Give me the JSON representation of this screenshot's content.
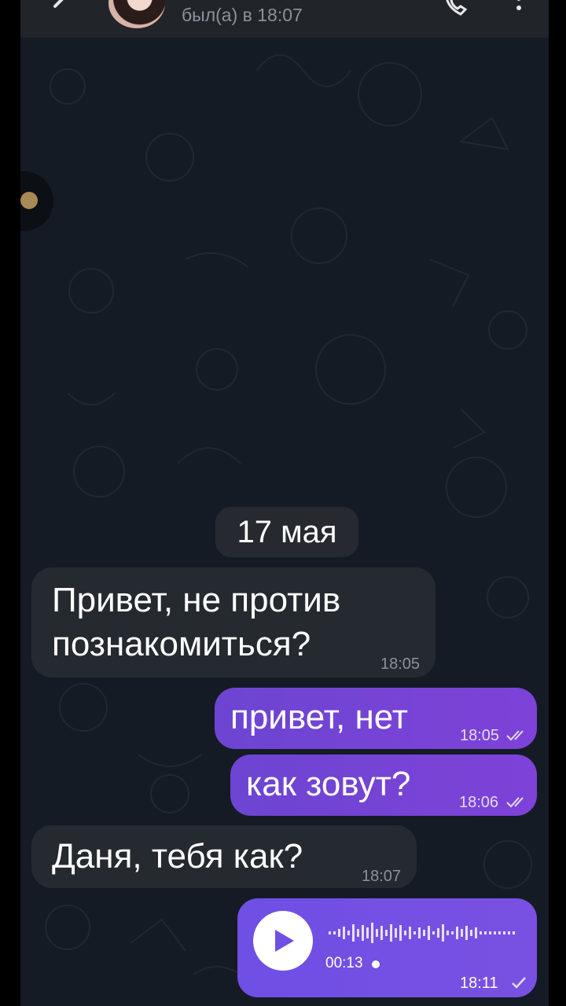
{
  "header": {
    "status": "был(а) в 18:07",
    "icons": [
      "back-arrow-icon",
      "avatar",
      "phone-icon",
      "more-vertical-icon"
    ]
  },
  "chat": {
    "date": "17 мая",
    "messages": [
      {
        "direction": "in",
        "text": "Привет, не против\nпознакомиться?",
        "time": "18:05"
      },
      {
        "direction": "out",
        "text": "привет, нет",
        "time": "18:05",
        "status": "read"
      },
      {
        "direction": "out",
        "text": "как зовут?",
        "time": "18:06",
        "status": "read"
      },
      {
        "direction": "in",
        "text": "Даня, тебя как?",
        "time": "18:07"
      },
      {
        "direction": "out",
        "type": "voice",
        "duration": "00:13",
        "time": "18:11",
        "status": "sent"
      }
    ]
  },
  "colors": {
    "background": "#141b24",
    "header": "#212429",
    "incoming_bubble": "#252930",
    "outgoing_bubble": "#7442d6",
    "voice_bubble": "#7350e3"
  }
}
